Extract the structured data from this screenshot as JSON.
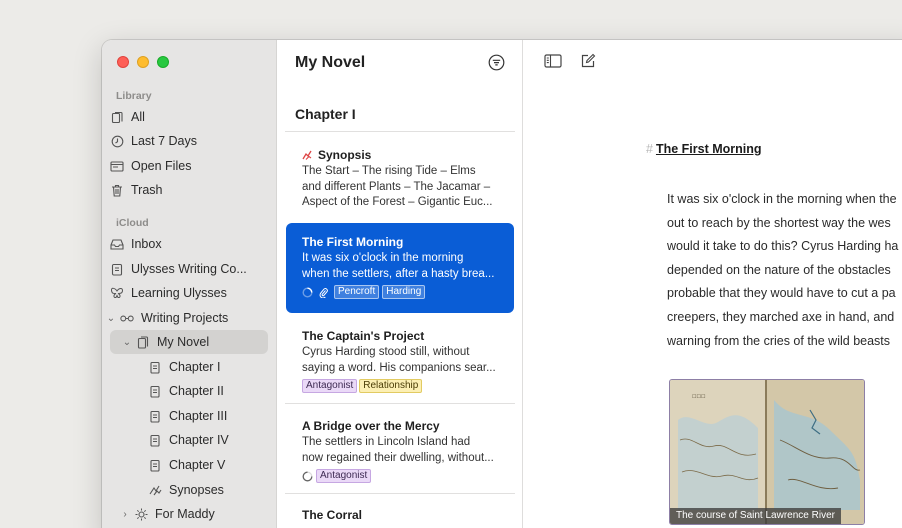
{
  "sidebar": {
    "library_label": "Library",
    "library_items": [
      {
        "label": "All",
        "icon": "all-sheets-icon"
      },
      {
        "label": "Last 7 Days",
        "icon": "clock-icon"
      },
      {
        "label": "Open Files",
        "icon": "open-files-icon"
      },
      {
        "label": "Trash",
        "icon": "trash-icon"
      }
    ],
    "icloud_label": "iCloud",
    "icloud_items": [
      {
        "label": "Inbox",
        "icon": "inbox-icon"
      },
      {
        "label": "Ulysses Writing Co...",
        "icon": "document-icon"
      },
      {
        "label": "Learning Ulysses",
        "icon": "butterfly-icon"
      },
      {
        "label": "Writing Projects",
        "icon": "glasses-icon"
      },
      {
        "label": "My Novel",
        "icon": "book-icon"
      },
      {
        "label": "Chapter I",
        "icon": "sheet-icon"
      },
      {
        "label": "Chapter II",
        "icon": "sheet-icon"
      },
      {
        "label": "Chapter III",
        "icon": "sheet-icon"
      },
      {
        "label": "Chapter IV",
        "icon": "sheet-icon"
      },
      {
        "label": "Chapter V",
        "icon": "sheet-icon"
      },
      {
        "label": "Synopses",
        "icon": "synopsis-icon"
      },
      {
        "label": "For Maddy",
        "icon": "sun-icon"
      }
    ]
  },
  "list": {
    "title": "My Novel",
    "chapter": "Chapter I",
    "cards": [
      {
        "title": "Synopsis",
        "text1": "The Start – The rising Tide – Elms",
        "text2": "and different Plants – The Jacamar –",
        "text3": "Aspect of the Forest – Gigantic Euc..."
      },
      {
        "title": "The First Morning",
        "text1": "It was six o'clock in the morning",
        "text2": "when the settlers, after a hasty brea...",
        "tags": [
          "Pencroft",
          "Harding"
        ]
      },
      {
        "title": "The Captain's Project",
        "text1": "Cyrus Harding stood still, without",
        "text2": "saying a word. His companions sear...",
        "tags": [
          "Antagonist",
          "Relationship"
        ]
      },
      {
        "title": "A Bridge over the Mercy",
        "text1": "The settlers in Lincoln Island had",
        "text2": "now regained their dwelling, without...",
        "tags": [
          "Antagonist"
        ]
      },
      {
        "title": "The Corral"
      }
    ]
  },
  "editor": {
    "hash": "#",
    "heading": "The First Morning",
    "lines": [
      "It was six o'clock in the morning when the",
      "out to reach by the shortest way the wes",
      "would it take to do this? Cyrus Harding ha",
      "depended on the nature of the obstacles",
      "probable that they would have to cut a pa",
      "creepers, they marched axe in hand, and",
      "warning from the cries of the wild beasts"
    ],
    "image_caption": "The course of Saint Lawrence River"
  },
  "colors": {
    "selection": "#0a5dd6",
    "sidebar_bg": "#e6e5e4",
    "tag_keyword": "#ead9f7",
    "tag_relationship": "#fcefb4"
  }
}
